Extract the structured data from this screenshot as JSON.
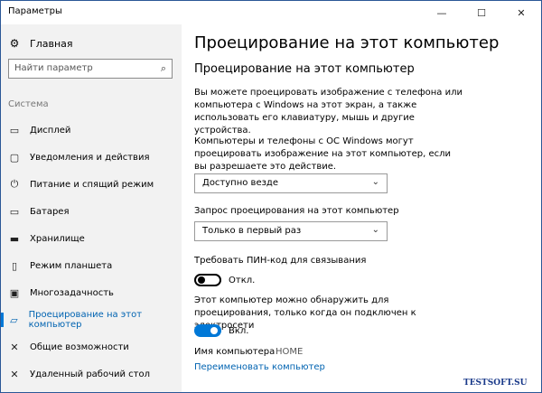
{
  "window": {
    "title": "Параметры",
    "min_glyph": "—",
    "max_glyph": "☐",
    "close_glyph": "✕"
  },
  "sidebar": {
    "home_label": "Главная",
    "search_placeholder": "Найти параметр",
    "section_title": "Система",
    "items": [
      {
        "label": "Дисплей",
        "icon": "display-icon",
        "glyph": "▭"
      },
      {
        "label": "Уведомления и действия",
        "icon": "notifications-icon",
        "glyph": "▢"
      },
      {
        "label": "Питание и спящий режим",
        "icon": "power-icon",
        "glyph": "⏻"
      },
      {
        "label": "Батарея",
        "icon": "battery-icon",
        "glyph": "▭"
      },
      {
        "label": "Хранилище",
        "icon": "storage-icon",
        "glyph": "▬"
      },
      {
        "label": "Режим планшета",
        "icon": "tablet-mode-icon",
        "glyph": "▯"
      },
      {
        "label": "Многозадачность",
        "icon": "multitasking-icon",
        "glyph": "▣"
      },
      {
        "label": "Проецирование на этот компьютер",
        "icon": "projecting-icon",
        "glyph": "▱"
      },
      {
        "label": "Общие возможности",
        "icon": "shared-experiences-icon",
        "glyph": "✕"
      },
      {
        "label": "Удаленный рабочий стол",
        "icon": "remote-desktop-icon",
        "glyph": "✕"
      }
    ],
    "active_index": 7
  },
  "main": {
    "page_title": "Проецирование на этот компьютер",
    "section_title": "Проецирование на этот компьютер",
    "description": "Вы можете проецировать изображение с телефона или компьютера с Windows на этот экран, а также использовать его клавиатуру, мышь и другие устройства.",
    "availability_label": "Компьютеры и телефоны с ОС Windows могут проецировать изображение на этот компьютер, если вы разрешаете это действие.",
    "availability_value": "Доступно везде",
    "request_label": "Запрос проецирования на этот компьютер",
    "request_value": "Только в первый раз",
    "pin_label": "Требовать ПИН-код для связывания",
    "pin_state": "Откл.",
    "power_label": "Этот компьютер можно обнаружить для проецирования, только когда он подключен к электросети",
    "power_state": "Вкл.",
    "pc_name_label": "Имя компьютера",
    "pc_name_value": "HOME",
    "rename_link": "Переименовать компьютер"
  },
  "watermark": "TESTSOFT.SU",
  "colors": {
    "accent": "#0078d7",
    "link": "#0063b1",
    "sidebar_bg": "#f2f2f2"
  }
}
